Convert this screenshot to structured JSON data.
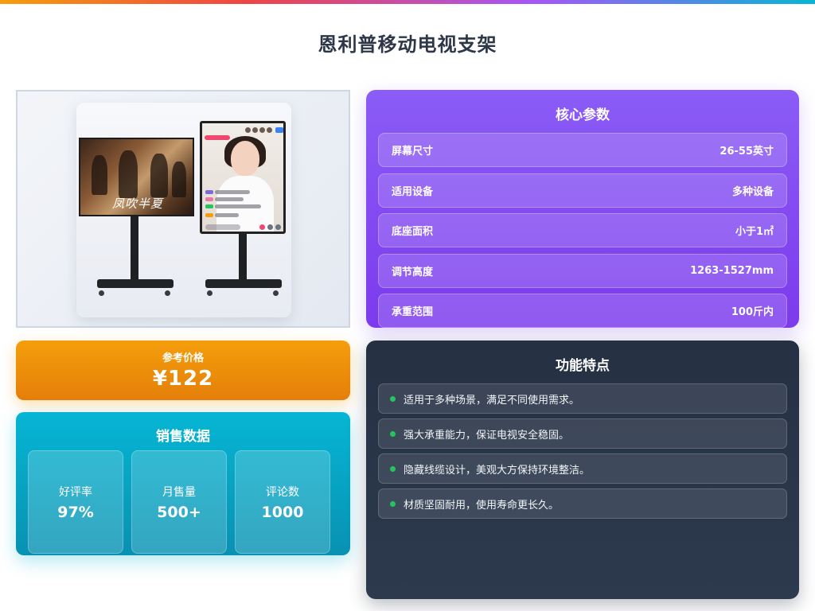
{
  "page": {
    "title": "恩利普移动电视支架"
  },
  "colors": {
    "accent_bar": [
      "#f59e0b",
      "#ef4444",
      "#a855f7",
      "#06b6d4"
    ],
    "params_bg": "#8b5cf6",
    "price_bg": "#f59e0b",
    "sales_bg": "#06b6d4",
    "features_bg": "#253043",
    "bullet": "#22c55e"
  },
  "product_image": {
    "screen_caption": "凤吹半夏"
  },
  "params": {
    "title": "核心参数",
    "rows": [
      {
        "label": "屏幕尺寸",
        "value": "26-55英寸"
      },
      {
        "label": "适用设备",
        "value": "多种设备"
      },
      {
        "label": "底座面积",
        "value": "小于1㎡"
      },
      {
        "label": "调节高度",
        "value": "1263-1527mm"
      },
      {
        "label": "承重范围",
        "value": "100斤内"
      }
    ]
  },
  "price": {
    "label": "参考价格",
    "value": "¥122"
  },
  "sales": {
    "title": "销售数据",
    "stats": [
      {
        "label": "好评率",
        "value": "97%"
      },
      {
        "label": "月售量",
        "value": "500+"
      },
      {
        "label": "评论数",
        "value": "1000"
      }
    ]
  },
  "features": {
    "title": "功能特点",
    "items": [
      "适用于多种场景，满足不同使用需求。",
      "强大承重能力，保证电视安全稳固。",
      "隐藏线缆设计，美观大方保持环境整洁。",
      "材质坚固耐用，使用寿命更长久。"
    ]
  }
}
